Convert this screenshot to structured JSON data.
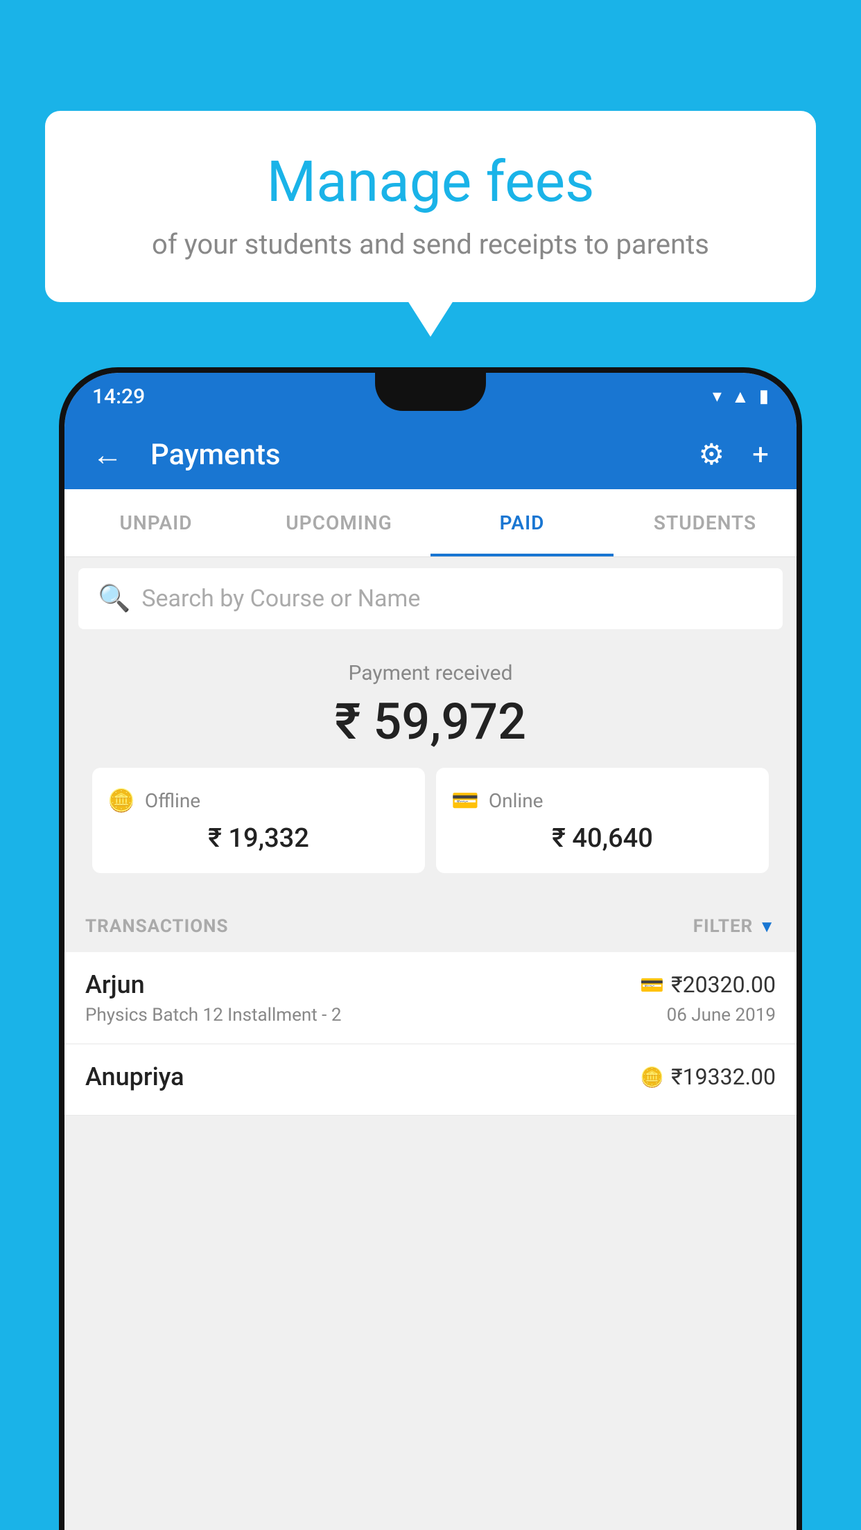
{
  "background_color": "#1ab3e8",
  "speech_bubble": {
    "title": "Manage fees",
    "subtitle": "of your students and send receipts to parents"
  },
  "status_bar": {
    "time": "14:29"
  },
  "app_header": {
    "title": "Payments",
    "back_label": "←",
    "settings_label": "⚙",
    "add_label": "+"
  },
  "tabs": [
    {
      "label": "UNPAID",
      "active": false
    },
    {
      "label": "UPCOMING",
      "active": false
    },
    {
      "label": "PAID",
      "active": true
    },
    {
      "label": "STUDENTS",
      "active": false
    }
  ],
  "search": {
    "placeholder": "Search by Course or Name"
  },
  "payment_summary": {
    "label": "Payment received",
    "amount": "₹ 59,972",
    "offline": {
      "type": "Offline",
      "amount": "₹ 19,332"
    },
    "online": {
      "type": "Online",
      "amount": "₹ 40,640"
    }
  },
  "transactions_header": {
    "label": "TRANSACTIONS",
    "filter_label": "FILTER"
  },
  "transactions": [
    {
      "name": "Arjun",
      "course": "Physics Batch 12 Installment - 2",
      "amount": "₹20320.00",
      "date": "06 June 2019",
      "method": "online"
    },
    {
      "name": "Anupriya",
      "course": "",
      "amount": "₹19332.00",
      "date": "",
      "method": "offline"
    }
  ]
}
